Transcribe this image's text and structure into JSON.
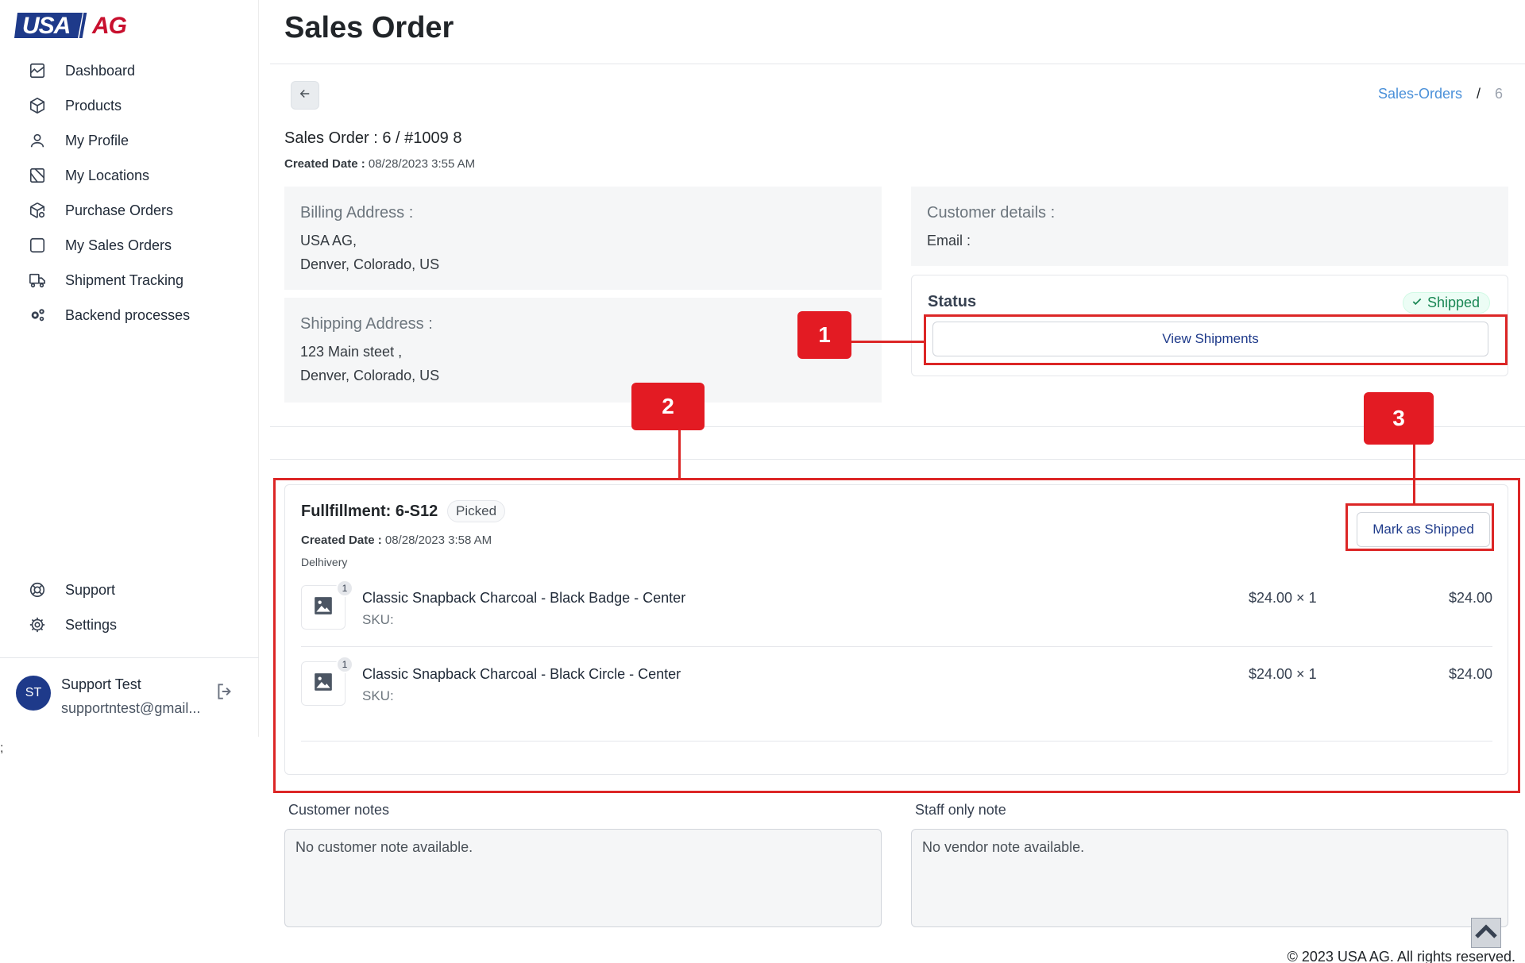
{
  "brand": {
    "logo_left": "USA",
    "logo_right": "AG"
  },
  "sidebar": {
    "items": [
      {
        "label": "Dashboard",
        "icon": "chart-icon"
      },
      {
        "label": "Products",
        "icon": "box-icon"
      },
      {
        "label": "My Profile",
        "icon": "user-icon"
      },
      {
        "label": "My Locations",
        "icon": "map-icon"
      },
      {
        "label": "Purchase Orders",
        "icon": "package-icon"
      },
      {
        "label": "My Sales Orders",
        "icon": "square-icon"
      },
      {
        "label": "Shipment Tracking",
        "icon": "truck-icon"
      },
      {
        "label": "Backend processes",
        "icon": "gears-icon"
      }
    ],
    "bottom_items": [
      {
        "label": "Support",
        "icon": "lifebuoy-icon"
      },
      {
        "label": "Settings",
        "icon": "gear-icon"
      }
    ],
    "user": {
      "initials": "ST",
      "name": "Support Test",
      "email": "supportntest@gmail..."
    },
    "stray_text": ";"
  },
  "header": {
    "title": "Sales Order"
  },
  "breadcrumb": {
    "link": "Sales-Orders",
    "separator": "/",
    "current": "6"
  },
  "order": {
    "title": "Sales Order : 6 / #1009 8",
    "created_label": "Created Date :",
    "created_value": "08/28/2023 3:55 AM"
  },
  "billing": {
    "heading": "Billing Address :",
    "line1": "USA AG,",
    "line2": "Denver, Colorado, US"
  },
  "shipping": {
    "heading": "Shipping Address :",
    "line1": "123 Main steet ,",
    "line2": "Denver, Colorado, US"
  },
  "customer": {
    "heading": "Customer details :",
    "email_label": "Email :"
  },
  "status": {
    "label": "Status",
    "badge": "Shipped",
    "view_button": "View Shipments"
  },
  "fulfillment": {
    "title": "Fullfillment: 6-S12",
    "badge": "Picked",
    "created_label": "Created Date :",
    "created_value": "08/28/2023 3:58 AM",
    "carrier": "Delhivery",
    "mark_button": "Mark as Shipped",
    "items": [
      {
        "qty": "1",
        "name": "Classic Snapback Charcoal - Black Badge - Center",
        "sku": "SKU:",
        "price": "$24.00 × 1",
        "total": "$24.00"
      },
      {
        "qty": "1",
        "name": "Classic Snapback Charcoal - Black Circle - Center",
        "sku": "SKU:",
        "price": "$24.00 × 1",
        "total": "$24.00"
      }
    ]
  },
  "notes": {
    "customer_label": "Customer notes",
    "customer_text": "No customer note available.",
    "staff_label": "Staff only note",
    "staff_text": "No vendor note available."
  },
  "footer": {
    "text": "© 2023 USA AG. All rights reserved."
  },
  "annotations": {
    "one": "1",
    "two": "2",
    "three": "3"
  },
  "colors": {
    "annotation_red": "#dc2626",
    "brand_blue": "#1e3a8a",
    "brand_red": "#c8102e",
    "link_blue": "#4a90d9",
    "success_green": "#198754"
  }
}
